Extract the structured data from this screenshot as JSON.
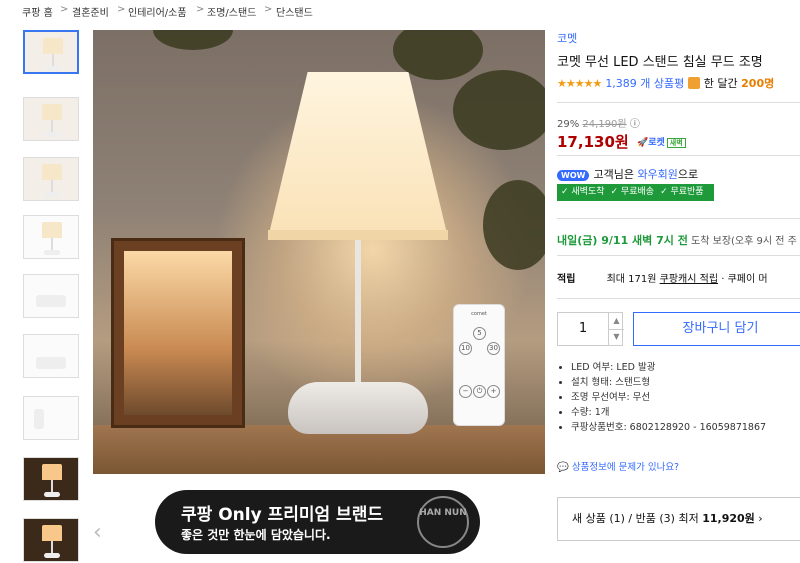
{
  "breadcrumb": [
    "쿠팡 홈",
    "결혼준비",
    "인테리어/소품",
    "조명/스탠드",
    "단스탠드"
  ],
  "breadcrumb_sep": ">",
  "thumbnails_count": 11,
  "remote": {
    "brand": "comet",
    "b5": "5",
    "b10": "10",
    "b30": "30",
    "minus": "−",
    "power": "⏻",
    "plus": "+"
  },
  "banner": {
    "line1": "쿠팡 Only 프리미엄 브랜드",
    "line2": "좋은 것만 한눈에 담았습니다.",
    "badge": "HAN NUN"
  },
  "nav": {
    "prev_arrow": "‹"
  },
  "product": {
    "brand": "코멧",
    "title": "코멧 무선 LED 스탠드 침실 무드 조명",
    "stars": "★★★★★",
    "review_count": "1,389 개 상품평",
    "month_label": "한 달간",
    "month_count": "200명",
    "discount": "29%",
    "original_price": "24,190원",
    "price": "17,130원",
    "rocket": "로켓",
    "rocket_new": "새벽",
    "wow_badge": "WOW",
    "wow_pre": "고객님은",
    "wow_link": "와우회원",
    "wow_post": "으로",
    "benefits": [
      "✓ 새벽도착",
      "✓ 무료배송",
      "✓ 무료반품"
    ],
    "delivery_main": "내일(금) 9/11 새벽 7시 전",
    "delivery_sub": "도착 보장(오후 9시 전 주",
    "cash_key": "적립",
    "cash_text1": "최대 171원",
    "cash_link": "쿠팡캐시 적립",
    "cash_text2": "· 쿠페이 머",
    "quantity": "1",
    "qty_up": "▲",
    "qty_down": "▼",
    "cart_label": "장바구니 담기",
    "specs": [
      "LED 여부: LED 발광",
      "설치 형태: 스탠드형",
      "조명 무선여부: 무선",
      "수량: 1개",
      "쿠팡상품번호: 6802128920 - 16059871867"
    ],
    "report_link": "상품정보에 문제가 있나요?",
    "seller_pre": "새 상품 (1) / 반품 (3) 최저",
    "seller_price": "11,920원",
    "seller_arrow": "›"
  }
}
